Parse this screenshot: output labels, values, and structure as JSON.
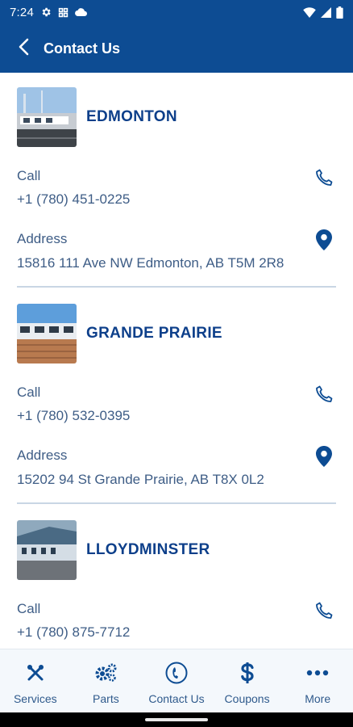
{
  "status_bar": {
    "time": "7:24",
    "icons": [
      "gear-icon",
      "grid-icon",
      "cloud-icon",
      "wifi-icon",
      "signal-icon",
      "battery-icon"
    ]
  },
  "app_bar": {
    "title": "Contact Us",
    "back_icon": "chevron-left-icon"
  },
  "locations": [
    {
      "name": "EDMONTON",
      "call_label": "Call",
      "phone": "+1 (780) 451-0225",
      "address_label": "Address",
      "address": "15816 111 Ave NW Edmonton, AB T5M 2R8"
    },
    {
      "name": "GRANDE PRAIRIE",
      "call_label": "Call",
      "phone": "+1 (780) 532-0395",
      "address_label": "Address",
      "address": "15202 94 St Grande Prairie, AB T8X 0L2"
    },
    {
      "name": "LLOYDMINSTER",
      "call_label": "Call",
      "phone": "+1 (780) 875-7712"
    }
  ],
  "bottom_nav": [
    {
      "label": "Services",
      "icon": "tools-icon"
    },
    {
      "label": "Parts",
      "icon": "gears-icon"
    },
    {
      "label": "Contact Us",
      "icon": "phone-circle-icon"
    },
    {
      "label": "Coupons",
      "icon": "dollar-icon"
    },
    {
      "label": "More",
      "icon": "more-dots-icon"
    }
  ],
  "colors": {
    "brand_blue": "#0d4c93",
    "heading_blue": "#0d3f8a",
    "text_blue": "#3e5d86",
    "divider": "#c9d6e4"
  }
}
